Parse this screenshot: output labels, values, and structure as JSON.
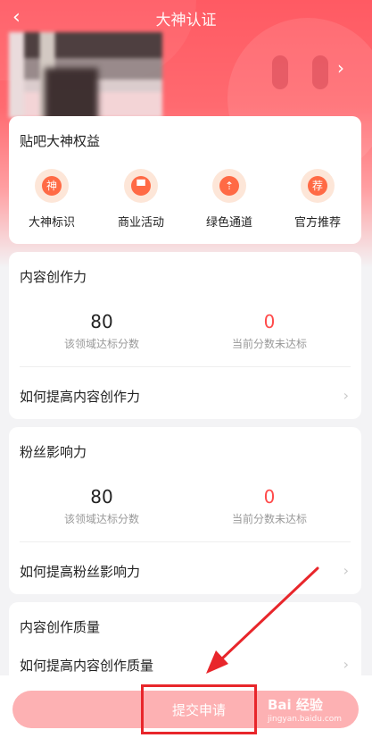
{
  "nav": {
    "title": "大神认证",
    "back_icon": "‹"
  },
  "profile": {
    "arrow": "›"
  },
  "benefits": {
    "title": "贴吧大神权益",
    "items": [
      {
        "label": "大神标识",
        "glyph": "神",
        "icon": "god-badge-icon"
      },
      {
        "label": "商业活动",
        "glyph": "▀",
        "icon": "shopping-bag-icon"
      },
      {
        "label": "绿色通道",
        "glyph": "⇡",
        "icon": "green-channel-icon"
      },
      {
        "label": "官方推荐",
        "glyph": "荐",
        "icon": "recommend-icon"
      }
    ]
  },
  "content_power": {
    "title": "内容创作力",
    "target_value": "80",
    "target_caption": "该领域达标分数",
    "current_value": "0",
    "current_caption": "当前分数未达标",
    "link": "如何提高内容创作力"
  },
  "fan_influence": {
    "title": "粉丝影响力",
    "target_value": "80",
    "target_caption": "该领域达标分数",
    "current_value": "0",
    "current_caption": "当前分数未达标",
    "link": "如何提高粉丝影响力"
  },
  "content_quality": {
    "title": "内容创作质量",
    "link": "如何提高内容创作质量"
  },
  "submit": {
    "label": "提交申请"
  },
  "watermark": {
    "main": "Bai 经验",
    "sub": "jingyan.baidu.com"
  },
  "colors": {
    "accent_red": "#ff4a4a",
    "submit_bg": "#fdb1b3",
    "highlight_box": "#e8262b",
    "hero_red": "#ff5a63"
  }
}
